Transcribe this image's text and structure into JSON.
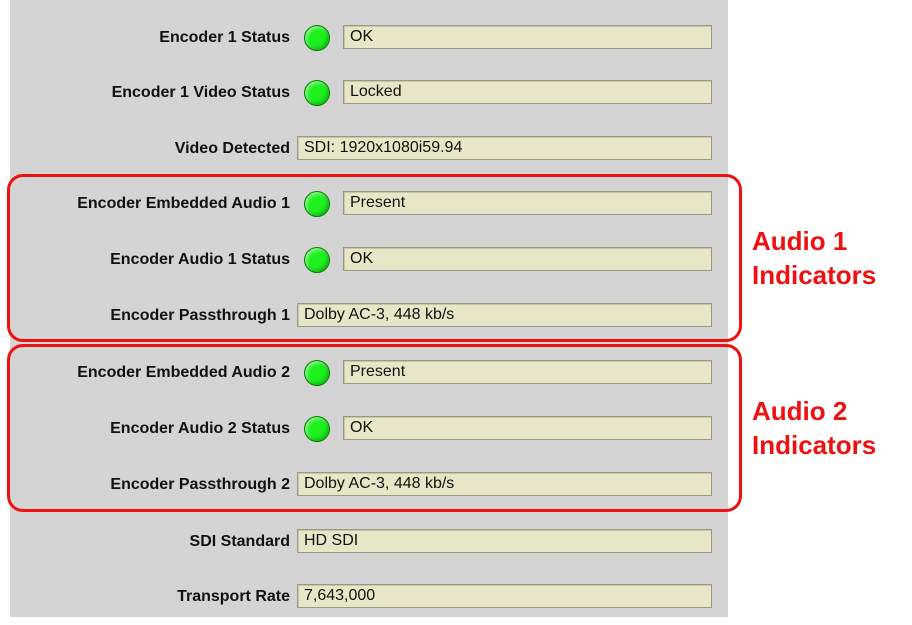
{
  "status_rows": [
    {
      "label": "Encoder 1 Status",
      "value": "OK",
      "led": "green"
    },
    {
      "label": "Encoder 1 Video Status",
      "value": "Locked",
      "led": "green"
    },
    {
      "label": "Video Detected",
      "value": "SDI: 1920x1080i59.94",
      "led": null
    },
    {
      "label": "Encoder Embedded Audio 1",
      "value": "Present",
      "led": "green"
    },
    {
      "label": "Encoder Audio 1 Status",
      "value": "OK",
      "led": "green"
    },
    {
      "label": "Encoder Passthrough 1",
      "value": "Dolby AC-3, 448 kb/s",
      "led": null
    },
    {
      "label": "Encoder Embedded Audio 2",
      "value": "Present",
      "led": "green"
    },
    {
      "label": "Encoder Audio 2 Status",
      "value": "OK",
      "led": "green"
    },
    {
      "label": "Encoder Passthrough 2",
      "value": "Dolby AC-3, 448 kb/s",
      "led": null
    },
    {
      "label": "SDI Standard",
      "value": "HD SDI",
      "led": null
    },
    {
      "label": "Transport Rate",
      "value": "7,643,000",
      "led": null
    }
  ],
  "annotations": [
    {
      "line1": "Audio 1",
      "line2": "Indicators"
    },
    {
      "line1": "Audio 2",
      "line2": "Indicators"
    }
  ],
  "colors": {
    "panel_background": "#d4d4d4",
    "field_background": "#e8e6c6",
    "led_ok": "#1ef01e",
    "annotation": "#ee1111"
  }
}
